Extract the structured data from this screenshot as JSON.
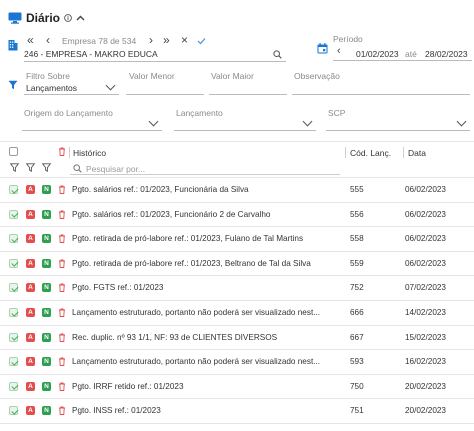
{
  "header": {
    "title": "Diário",
    "colors": {
      "accent": "#1976d2",
      "tag_a": "#e44d4d",
      "tag_n": "#2e9e4f",
      "trash": "#e44d4d"
    }
  },
  "company_nav": {
    "counter": "Empresa 78 de 534",
    "first": "«",
    "prev": "‹",
    "next": "›",
    "last": "»",
    "clear": "×",
    "company_name": "246 - EMPRESA - MAKRO EDUCA"
  },
  "period": {
    "label": "Período",
    "start": "01/02/2023",
    "separator": "até",
    "end": "28/02/2023"
  },
  "filters": {
    "filtro_sobre_label": "Filtro Sobre",
    "filtro_sobre_value": "Lançamentos",
    "valor_menor_label": "Valor Menor",
    "valor_maior_label": "Valor Maior",
    "observacao_label": "Observação",
    "origem_label": "Origem do Lançamento",
    "lancamento_label": "Lançamento",
    "scp_label": "SCP"
  },
  "table": {
    "columns": {
      "historico": "Histórico",
      "cod": "Cód. Lanç.",
      "data": "Data"
    },
    "search_placeholder": "Pesquisar por...",
    "rows": [
      {
        "historico": "Pgto. salários ref.: 01/2023, Funcionária da Silva",
        "cod": "555",
        "data": "06/02/2023"
      },
      {
        "historico": "Pgto. salários ref.: 01/2023, Funcionário 2 de Carvalho",
        "cod": "556",
        "data": "06/02/2023"
      },
      {
        "historico": "Pgto. retirada de pró-labore ref.: 01/2023, Fulano de Tal Martins",
        "cod": "558",
        "data": "06/02/2023"
      },
      {
        "historico": "Pgto. retirada de pró-labore ref.: 01/2023, Beltrano de Tal da Silva",
        "cod": "559",
        "data": "06/02/2023"
      },
      {
        "historico": "Pgto. FGTS ref.: 01/2023",
        "cod": "752",
        "data": "07/02/2023"
      },
      {
        "historico": "Lançamento estruturado, portanto não poderá ser visualizado nest...",
        "cod": "666",
        "data": "14/02/2023"
      },
      {
        "historico": "Rec. duplic. nº 93 1/1, NF: 93 de CLIENTES DIVERSOS",
        "cod": "667",
        "data": "15/02/2023"
      },
      {
        "historico": "Lançamento estruturado, portanto não poderá ser visualizado nest...",
        "cod": "593",
        "data": "16/02/2023"
      },
      {
        "historico": "Pgto. IRRF retido ref.: 01/2023",
        "cod": "750",
        "data": "20/02/2023"
      },
      {
        "historico": "Pgto. INSS ref.: 01/2023",
        "cod": "751",
        "data": "20/02/2023"
      }
    ]
  }
}
